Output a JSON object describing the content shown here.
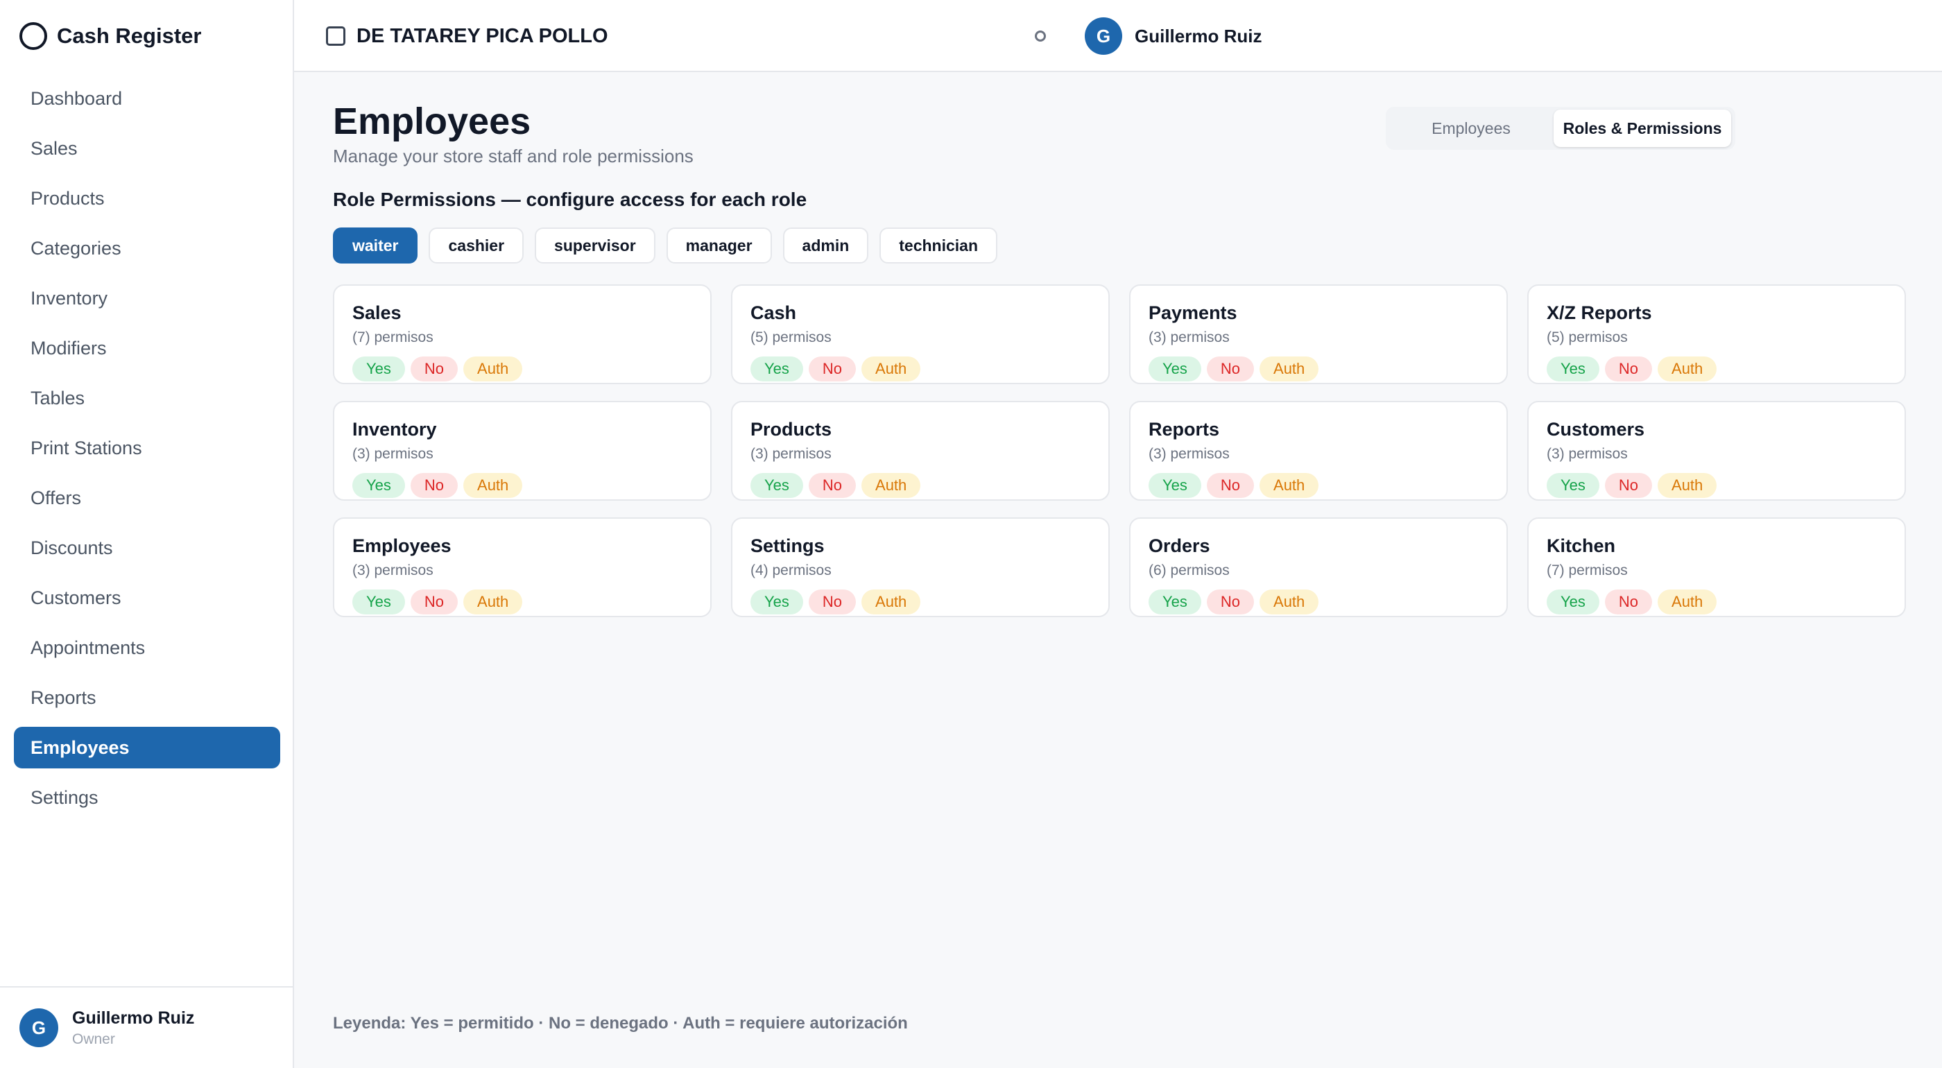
{
  "app": {
    "title": "Cash Register"
  },
  "sidebar": {
    "items": [
      {
        "label": "Dashboard"
      },
      {
        "label": "Sales"
      },
      {
        "label": "Products"
      },
      {
        "label": "Categories"
      },
      {
        "label": "Inventory"
      },
      {
        "label": "Modifiers"
      },
      {
        "label": "Tables"
      },
      {
        "label": "Print Stations"
      },
      {
        "label": "Offers"
      },
      {
        "label": "Discounts"
      },
      {
        "label": "Customers"
      },
      {
        "label": "Appointments"
      },
      {
        "label": "Reports"
      },
      {
        "label": "Employees",
        "active": true
      },
      {
        "label": "Settings"
      }
    ],
    "user": {
      "initial": "G",
      "name": "Guillermo Ruiz",
      "role": "Owner"
    }
  },
  "header": {
    "store_name": "DE TATAREY PICA POLLO",
    "user": {
      "initial": "G",
      "name": "Guillermo Ruiz"
    }
  },
  "page": {
    "title": "Employees",
    "subtitle": "Manage your store staff and role permissions",
    "toggle": {
      "employees": "Employees",
      "roles": "Roles & Permissions",
      "active": "roles"
    },
    "section_title": "Role Permissions — configure access for each role",
    "roles": [
      "waiter",
      "cashier",
      "supervisor",
      "manager",
      "admin",
      "technician"
    ],
    "active_role": "waiter",
    "pill_labels": {
      "yes": "Yes",
      "no": "No",
      "auth": "Auth"
    },
    "modules": [
      {
        "name": "Sales",
        "count": "(7) permisos"
      },
      {
        "name": "Cash",
        "count": "(5) permisos"
      },
      {
        "name": "Payments",
        "count": "(3) permisos"
      },
      {
        "name": "X/Z Reports",
        "count": "(5) permisos"
      },
      {
        "name": "Inventory",
        "count": "(3) permisos"
      },
      {
        "name": "Products",
        "count": "(3) permisos"
      },
      {
        "name": "Reports",
        "count": "(3) permisos"
      },
      {
        "name": "Customers",
        "count": "(3) permisos"
      },
      {
        "name": "Employees",
        "count": "(3) permisos"
      },
      {
        "name": "Settings",
        "count": "(4) permisos"
      },
      {
        "name": "Orders",
        "count": "(6) permisos"
      },
      {
        "name": "Kitchen",
        "count": "(7) permisos"
      }
    ],
    "legend": "Leyenda: Yes = permitido · No = denegado · Auth = requiere autorización"
  },
  "colors": {
    "accent": "#1e67ad",
    "yes_bg": "#dcf5e6",
    "yes_fg": "#16a34a",
    "no_bg": "#fde2e2",
    "no_fg": "#dc2626",
    "auth_bg": "#fdf3d0",
    "auth_fg": "#d97706"
  }
}
